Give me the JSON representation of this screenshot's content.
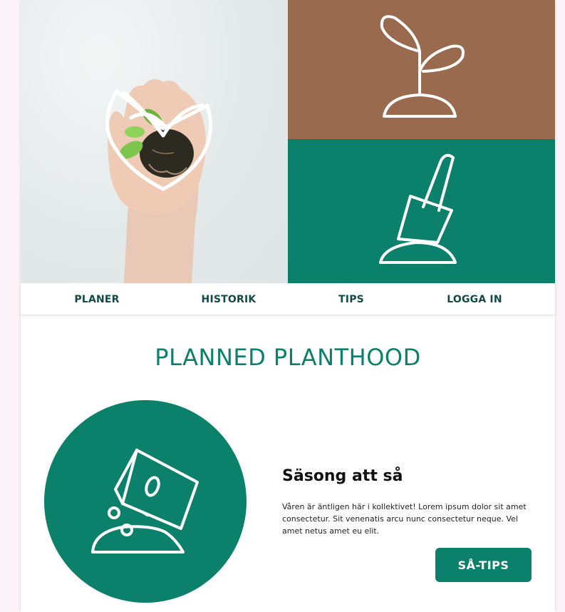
{
  "hero": {
    "photo_icon": "heart-sprout-icon",
    "top_right_icon": "sprout-icon",
    "bottom_right_icon": "shovel-icon",
    "colors": {
      "brown": "#9a6a4e",
      "green": "#0b816c"
    }
  },
  "nav": {
    "items": [
      {
        "label": "PLANER"
      },
      {
        "label": "HISTORIK"
      },
      {
        "label": "TIPS"
      },
      {
        "label": "LOGGA IN"
      }
    ]
  },
  "main": {
    "title": "PLANNED PLANTHOOD",
    "card": {
      "icon": "seed-bag-icon",
      "heading": "Säsong att så",
      "text": "Våren är äntligen här i kollektivet! Lorem ipsum dolor sit amet consectetur. Sit venenatis arcu nunc consectetur neque. Vel amet netus amet eu elit.",
      "button_label": "SÅ-TIPS"
    }
  }
}
